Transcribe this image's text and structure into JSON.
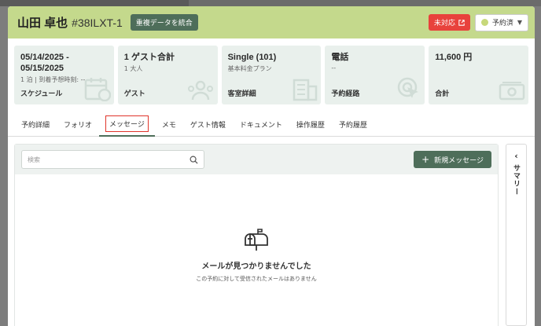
{
  "header": {
    "guest_name": "山田 卓也",
    "reservation_id": "#38ILXT-1",
    "merge_label": "重複データを統合",
    "unhandled_label": "未対応",
    "status_label": "予約済"
  },
  "cards": [
    {
      "title": "05/14/2025 - 05/15/2025",
      "sub": "1 泊 | 到着予想時刻: --",
      "label": "スケジュール",
      "icon": "calendar-icon"
    },
    {
      "title": "1 ゲスト合計",
      "sub": "1 大人",
      "label": "ゲスト",
      "icon": "guests-icon"
    },
    {
      "title": "Single (101)",
      "sub": "基本料金プラン",
      "label": "客室詳細",
      "icon": "building-icon"
    },
    {
      "title": "電話",
      "sub": "--",
      "label": "予約経路",
      "icon": "cursor-click-icon"
    },
    {
      "title": "11,600 円",
      "sub": "",
      "label": "合計",
      "icon": "money-icon"
    }
  ],
  "tabs": [
    "予約詳細",
    "フォリオ",
    "メッセージ",
    "メモ",
    "ゲスト情報",
    "ドキュメント",
    "操作履歴",
    "予約履歴"
  ],
  "active_tab": "メッセージ",
  "messages": {
    "search_placeholder": "検索",
    "new_label": "新規メッセージ",
    "empty_title": "メールが見つかりませんでした",
    "empty_sub": "この予約に対して受信されたメールはありません"
  },
  "summary": {
    "label": "サマリー"
  },
  "colors": {
    "header_bg": "#c4d98c",
    "primary": "#4e6e5a",
    "alert": "#e8423c",
    "card_bg": "#e9f0ec"
  }
}
